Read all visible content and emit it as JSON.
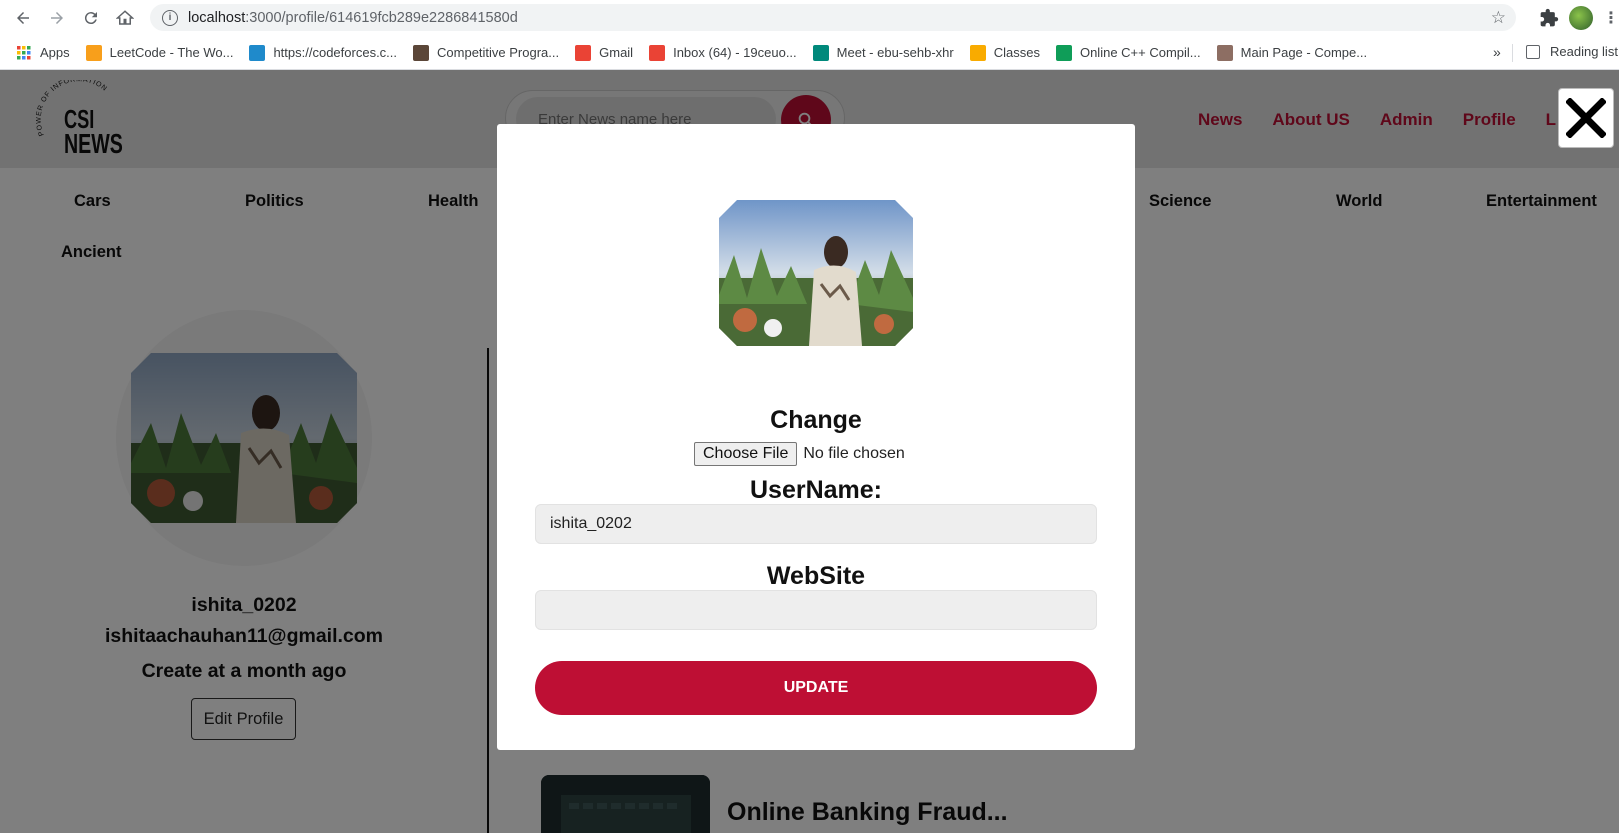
{
  "browser": {
    "url_host": "localhost",
    "url_path": ":3000/profile/614619fcb289e2286841580d",
    "bookmarks": [
      {
        "label": "Apps",
        "icon": "apps-grid-icon",
        "color": "#4285f4"
      },
      {
        "label": "LeetCode - The Wo...",
        "icon": "leetcode-icon",
        "color": "#f89f1b"
      },
      {
        "label": "https://codeforces.c...",
        "icon": "codeforces-icon",
        "color": "#1f8acb"
      },
      {
        "label": "Competitive Progra...",
        "icon": "cc-icon",
        "color": "#5b4638"
      },
      {
        "label": "Gmail",
        "icon": "gmail-icon",
        "color": "#ea4335"
      },
      {
        "label": "Inbox (64) - 19ceuo...",
        "icon": "gmail-icon",
        "color": "#ea4335"
      },
      {
        "label": "Meet - ebu-sehb-xhr",
        "icon": "meet-icon",
        "color": "#00897b"
      },
      {
        "label": "Classes",
        "icon": "classroom-icon",
        "color": "#f9ab00"
      },
      {
        "label": "Online C++ Compil...",
        "icon": "code-icon",
        "color": "#0f9d58"
      },
      {
        "label": "Main Page - Compe...",
        "icon": "wiki-icon",
        "color": "#8d6e63"
      }
    ],
    "more": "»",
    "reading_list": "Reading list"
  },
  "header": {
    "logo_arc": "POWER OF INFORMATION",
    "logo_line1": "CSI",
    "logo_line2": "NEWS",
    "search_placeholder": "Enter News name here",
    "nav": [
      "News",
      "About US",
      "Admin",
      "Profile",
      "L"
    ]
  },
  "categories_row1": [
    "Cars",
    "Politics",
    "Health",
    "Science",
    "World",
    "Entertainment"
  ],
  "categories_row2": [
    "Ancient"
  ],
  "profile": {
    "username": "ishita_0202",
    "email": "ishitaachauhan11@gmail.com",
    "created": "Create at a month ago",
    "edit_label": "Edit Profile"
  },
  "article": {
    "title": "Online Banking Fraud..."
  },
  "modal": {
    "change_label": "Change",
    "file_button": "Choose File",
    "file_status": "No file chosen",
    "username_label": "UserName:",
    "username_value": "ishita_0202",
    "website_label": "WebSite",
    "website_value": "",
    "update_label": "UPDATE"
  },
  "colors": {
    "brand": "#be0f34",
    "overlay": "rgba(0,0,0,0.5)"
  }
}
